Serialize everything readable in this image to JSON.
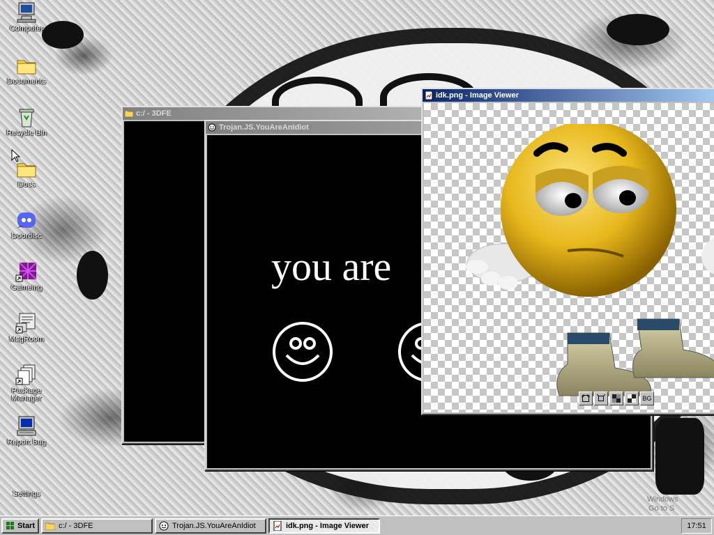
{
  "desktop": {
    "icons": [
      {
        "label": "Computer",
        "icon": "computer-icon"
      },
      {
        "label": "Documents",
        "icon": "folder-icon"
      },
      {
        "label": "Recycle Bin",
        "icon": "recycle-bin-icon"
      },
      {
        "label": "Docs",
        "icon": "folder-icon"
      },
      {
        "label": "Doordisc",
        "icon": "discord-icon"
      },
      {
        "label": "Gameing",
        "icon": "game-shortcut-icon"
      },
      {
        "label": "MsgRoom",
        "icon": "chat-icon"
      },
      {
        "label": "Package Manager",
        "icon": "package-icon"
      },
      {
        "label": "Report Bug",
        "icon": "bug-report-icon"
      },
      {
        "label": "Settings",
        "icon": "settings-icon"
      }
    ],
    "watermark": {
      "line1": "Windows",
      "line2": "Go to S"
    }
  },
  "windows": {
    "explorer": {
      "title": "c:/ - 3DFE"
    },
    "trojan": {
      "title": "Trojan.JS.YouAreAnIdiot",
      "text": "you are"
    },
    "viewer": {
      "title": "idk.png - Image Viewer",
      "toolbar": {
        "bg_label": "BG"
      }
    }
  },
  "taskbar": {
    "start_label": "Start",
    "buttons": [
      {
        "label": "c:/ - 3DFE"
      },
      {
        "label": "Trojan.JS.YouAreAnIdiot"
      },
      {
        "label": "idk.png - Image Viewer"
      }
    ],
    "clock": "17:51"
  },
  "colors": {
    "title_active": "#0a246a",
    "title_inactive": "#808080",
    "face_yellow": "#e8b81c"
  }
}
